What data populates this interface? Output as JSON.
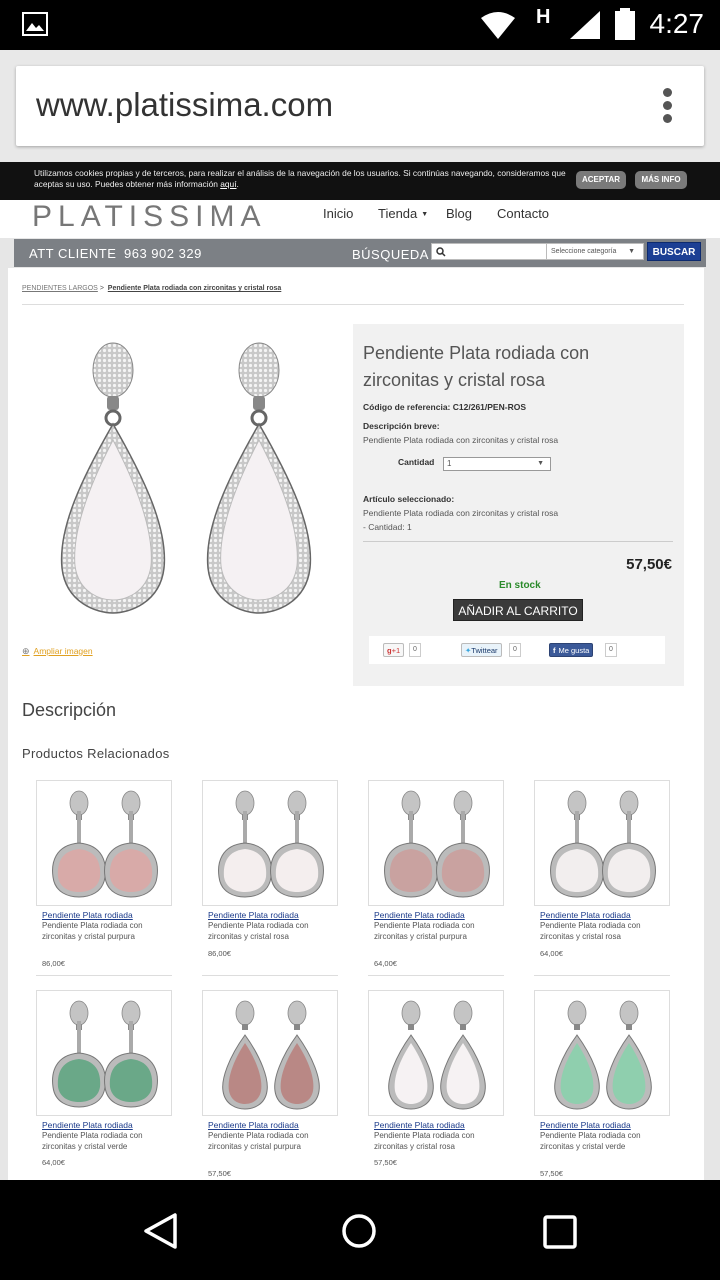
{
  "status_bar": {
    "time": "4:27",
    "network": "H"
  },
  "browser": {
    "url": "www.platissima.com"
  },
  "cookie_bar": {
    "text": "Utilizamos cookies propias y de terceros, para realizar el análisis de la navegación de los usuarios. Si continúas navegando, consideramos que aceptas su uso. Puedes obtener más información ",
    "link": "aquí",
    "text_end": ".",
    "accept_label": "ACEPTAR",
    "more_label": "MÁS INFO"
  },
  "header": {
    "logo": "PLATISSIMA",
    "nav": [
      "Inicio",
      "Tienda",
      "Blog",
      "Contacto"
    ]
  },
  "service_bar": {
    "att_label": "ATT CLIENTE",
    "phone": "963 902 329",
    "search_label": "BÚSQUEDA",
    "category_placeholder": "Seleccione categoría",
    "search_button": "BUSCAR"
  },
  "breadcrumb": {
    "parent": "PENDIENTES LARGOS",
    "separator": ">",
    "current": "Pendiente Plata rodiada con zirconitas y cristal rosa"
  },
  "product": {
    "title": "Pendiente Plata rodiada con zirconitas y cristal rosa",
    "ref_label": "Código de referencia:",
    "ref_value": "C12/261/PEN-ROS",
    "short_desc_label": "Descripción breve:",
    "short_desc": "Pendiente Plata rodiada con zirconitas y cristal rosa",
    "qty_label": "Cantidad",
    "qty_value": "1",
    "selected_label": "Artículo seleccionado:",
    "selected_name": "Pendiente Plata rodiada con zirconitas y cristal rosa",
    "selected_qty": "- Cantidad: 1",
    "price": "57,50€",
    "stock": "En stock",
    "cart_button": "AÑADIR AL CARRITO",
    "zoom_label": "Ampliar imagen",
    "stone_color": "#f5f1f3"
  },
  "social": {
    "gplus": "+1",
    "gplus_count": "0",
    "twitter": "Twittear",
    "twitter_count": "0",
    "facebook": "Me gusta",
    "facebook_count": "0"
  },
  "description_heading": "Descripción",
  "related_heading": "Productos Relacionados",
  "related": [
    {
      "name": "Pendiente Plata rodiada",
      "desc": "Pendiente Plata rodiada con zirconitas y cristal purpura",
      "price": "86,00€",
      "color": "#d8aaa8",
      "shape": "round"
    },
    {
      "name": "Pendiente Plata rodiada",
      "desc": "Pendiente Plata rodiada con zirconitas y cristal rosa",
      "price": "86,00€",
      "color": "#f4eeee",
      "shape": "round"
    },
    {
      "name": "Pendiente Plata rodiada",
      "desc": "Pendiente Plata rodiada con zirconitas y cristal purpura",
      "price": "64,00€",
      "color": "#c9a2a0",
      "shape": "round"
    },
    {
      "name": "Pendiente Plata rodiada",
      "desc": "Pendiente Plata rodiada con zirconitas y cristal rosa",
      "price": "64,00€",
      "color": "#f2eeee",
      "shape": "round"
    },
    {
      "name": "Pendiente Plata rodiada",
      "desc": "Pendiente Plata rodiada con zirconitas y cristal verde",
      "price": "64,00€",
      "color": "#6aa888",
      "shape": "round"
    },
    {
      "name": "Pendiente Plata rodiada",
      "desc": "Pendiente Plata rodiada con zirconitas y cristal purpura",
      "price": "57,50€",
      "color": "#b98885",
      "shape": "drop"
    },
    {
      "name": "Pendiente Plata rodiada",
      "desc": "Pendiente Plata rodiada con zirconitas y cristal rosa",
      "price": "57,50€",
      "color": "#f6f2f3",
      "shape": "drop"
    },
    {
      "name": "Pendiente Plata rodiada",
      "desc": "Pendiente Plata rodiada con zirconitas y cristal verde",
      "price": "57,50€",
      "color": "#8fcfae",
      "shape": "drop"
    }
  ],
  "nav_bar": {
    "back_icon": "back-icon",
    "home_icon": "home-icon",
    "recents_icon": "recents-icon"
  }
}
